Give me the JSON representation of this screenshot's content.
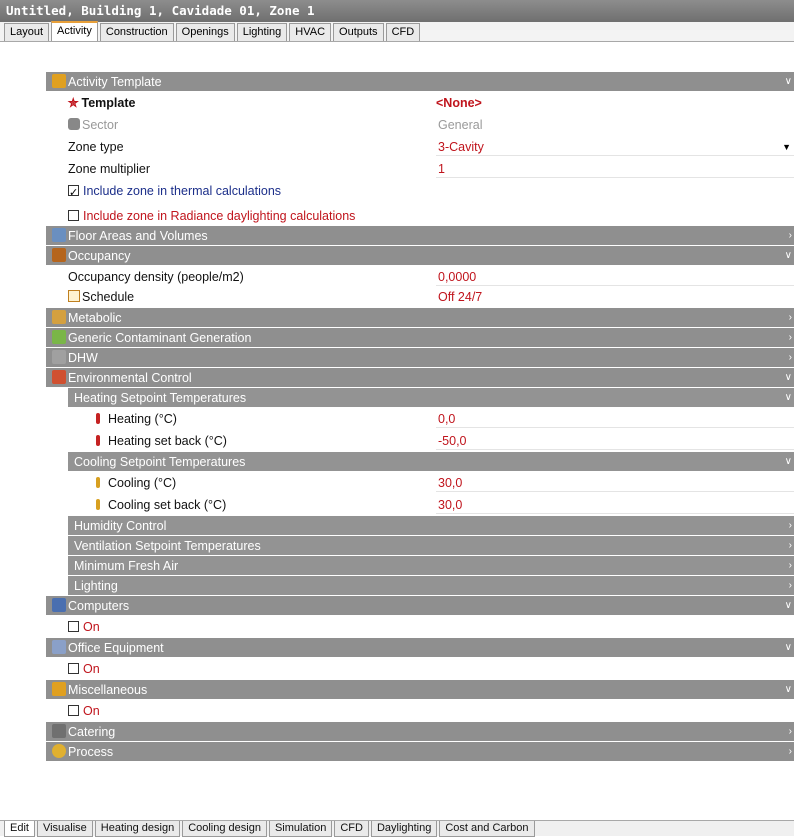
{
  "title": "Untitled, Building 1, Cavidade 01, Zone 1",
  "top_tabs": [
    "Layout",
    "Activity",
    "Construction",
    "Openings",
    "Lighting",
    "HVAC",
    "Outputs",
    "CFD"
  ],
  "active_top_tab": "Activity",
  "activity_template": {
    "header": "Activity Template",
    "template_label": "Template",
    "template_value": "<None>",
    "sector_label": "Sector",
    "sector_value": "General",
    "zone_type_label": "Zone type",
    "zone_type_value": "3-Cavity",
    "zone_multiplier_label": "Zone multiplier",
    "zone_multiplier_value": "1",
    "thermal_label": "Include zone in thermal calculations",
    "thermal_checked": true,
    "radiance_label": "Include zone in Radiance daylighting calculations",
    "radiance_checked": false
  },
  "floor_areas_header": "Floor Areas and Volumes",
  "occupancy": {
    "header": "Occupancy",
    "density_label": "Occupancy density (people/m2)",
    "density_value": "0,0000",
    "schedule_label": "Schedule",
    "schedule_value": "Off 24/7"
  },
  "metabolic_header": "Metabolic",
  "contaminant_header": "Generic Contaminant Generation",
  "dhw_header": "DHW",
  "environmental": {
    "header": "Environmental Control",
    "heating_header": "Heating Setpoint Temperatures",
    "heating_label": "Heating (°C)",
    "heating_value": "0,0",
    "heating_setback_label": "Heating set back (°C)",
    "heating_setback_value": "-50,0",
    "cooling_header": "Cooling Setpoint Temperatures",
    "cooling_label": "Cooling (°C)",
    "cooling_value": "30,0",
    "cooling_setback_label": "Cooling set back (°C)",
    "cooling_setback_value": "30,0",
    "humidity_header": "Humidity Control",
    "ventilation_header": "Ventilation Setpoint Temperatures",
    "fresh_air_header": "Minimum Fresh Air",
    "lighting_header": "Lighting"
  },
  "computers": {
    "header": "Computers",
    "on_label": "On"
  },
  "office": {
    "header": "Office Equipment",
    "on_label": "On"
  },
  "misc": {
    "header": "Miscellaneous",
    "on_label": "On"
  },
  "catering_header": "Catering",
  "process_header": "Process",
  "bottom_tabs": [
    "Edit",
    "Visualise",
    "Heating design",
    "Cooling design",
    "Simulation",
    "CFD",
    "Daylighting",
    "Cost and Carbon"
  ],
  "active_bottom_tab": "Edit",
  "colors": {
    "header_bg": "#8f8f8f",
    "value_red": "#c0141c",
    "blue_label": "#1c2f8a"
  }
}
